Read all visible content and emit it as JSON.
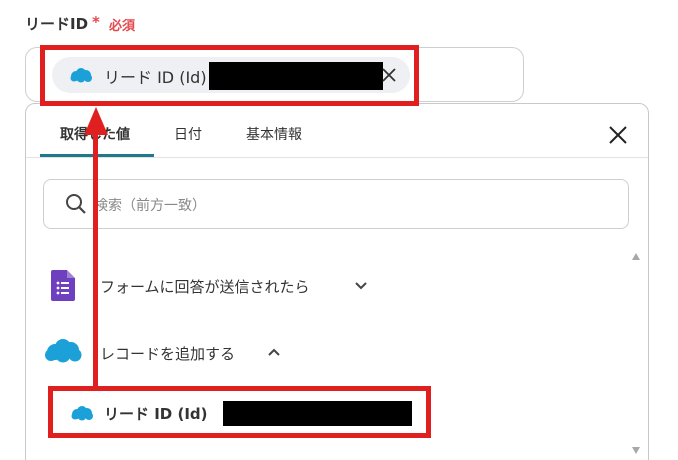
{
  "colors": {
    "required": "#e5484d",
    "annotation": "#e0201e",
    "salesforce": "#1ba0d8",
    "forms": "#6e3fbf",
    "tab_active": "#1e7a8a"
  },
  "field": {
    "label": "リードID",
    "required_mark": "*",
    "required_text": "必須",
    "selected_chip": {
      "icon": "salesforce-cloud-icon",
      "label": "リード ID (Id)"
    }
  },
  "panel": {
    "tabs": [
      {
        "label": "取得した値",
        "active": true
      },
      {
        "label": "日付",
        "active": false
      },
      {
        "label": "基本情報",
        "active": false
      }
    ],
    "close_icon": "close-icon",
    "search": {
      "placeholder": "検索（前方一致）",
      "icon": "search-icon"
    },
    "groups": [
      {
        "icon": "google-forms-icon",
        "label": "フォームに回答が送信されたら",
        "expanded": false
      },
      {
        "icon": "salesforce-cloud-icon",
        "label": "レコードを追加する",
        "expanded": true,
        "items": [
          {
            "icon": "salesforce-cloud-icon",
            "label": "リード ID (Id)"
          }
        ]
      }
    ]
  }
}
